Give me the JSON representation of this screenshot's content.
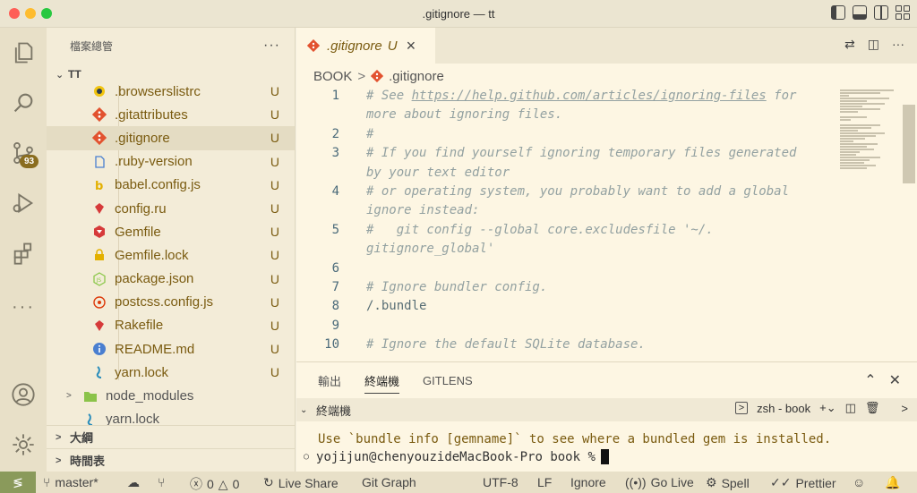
{
  "window": {
    "title": ".gitignore — tt"
  },
  "activity_bar": {
    "scm_badge": "93"
  },
  "sidebar": {
    "header": "檔案總管",
    "more": "···",
    "section": "TT",
    "files": [
      {
        "name": ".browserslistrc",
        "status": "U",
        "icon": "browserslist-icon"
      },
      {
        "name": ".gitattributes",
        "status": "U",
        "icon": "git-icon"
      },
      {
        "name": ".gitignore",
        "status": "U",
        "icon": "git-icon",
        "selected": true
      },
      {
        "name": ".ruby-version",
        "status": "U",
        "icon": "file-icon"
      },
      {
        "name": "babel.config.js",
        "status": "U",
        "icon": "babel-icon"
      },
      {
        "name": "config.ru",
        "status": "U",
        "icon": "ruby-icon"
      },
      {
        "name": "Gemfile",
        "status": "U",
        "icon": "gemfile-icon"
      },
      {
        "name": "Gemfile.lock",
        "status": "U",
        "icon": "lock-icon"
      },
      {
        "name": "package.json",
        "status": "U",
        "icon": "nodejs-icon"
      },
      {
        "name": "postcss.config.js",
        "status": "U",
        "icon": "postcss-icon"
      },
      {
        "name": "Rakefile",
        "status": "U",
        "icon": "ruby-icon"
      },
      {
        "name": "README.md",
        "status": "U",
        "icon": "info-icon"
      },
      {
        "name": "yarn.lock",
        "status": "U",
        "icon": "yarn-icon"
      }
    ],
    "folder": "node_modules",
    "root_file": "yarn.lock",
    "outline": "大綱",
    "timeline": "時間表"
  },
  "editor": {
    "tab_name": ".gitignore",
    "tab_status": "U",
    "breadcrumb_folder": "BOOK",
    "breadcrumb_file": ".gitignore",
    "lines": [
      {
        "num": "1",
        "parts": [
          "# See ",
          "https://help.github.com/articles/ignoring-files",
          " for"
        ]
      },
      {
        "num": "",
        "text": "more about ignoring files."
      },
      {
        "num": "2",
        "text": "#"
      },
      {
        "num": "3",
        "text": "# If you find yourself ignoring temporary files generated"
      },
      {
        "num": "",
        "text": "by your text editor"
      },
      {
        "num": "4",
        "text": "# or operating system, you probably want to add a global"
      },
      {
        "num": "",
        "text": "ignore instead:"
      },
      {
        "num": "5",
        "text": "#   git config --global core.excludesfile '~/."
      },
      {
        "num": "",
        "text": "gitignore_global'"
      },
      {
        "num": "6",
        "text": ""
      },
      {
        "num": "7",
        "text": "# Ignore bundler config."
      },
      {
        "num": "8",
        "text": "/.bundle",
        "plain": true
      },
      {
        "num": "9",
        "text": ""
      },
      {
        "num": "10",
        "text": "# Ignore the default SQLite database."
      }
    ]
  },
  "panel": {
    "tabs": [
      "輸出",
      "終端機",
      "GITLENS"
    ],
    "active_tab": "終端機",
    "terminal_title": "終端機",
    "shell_label": "zsh - book",
    "line1": "Use `bundle info [gemname]` to see where a bundled gem is installed.",
    "prompt": "yojijun@chenyouzideMacBook-Pro book %"
  },
  "statusbar": {
    "branch": "master*",
    "errors": "0",
    "warnings": "0",
    "live_share": "Live Share",
    "git_graph": "Git Graph",
    "encoding": "UTF-8",
    "eol": "LF",
    "language": "Ignore",
    "go_live": "Go Live",
    "spell": "Spell",
    "prettier": "Prettier"
  }
}
